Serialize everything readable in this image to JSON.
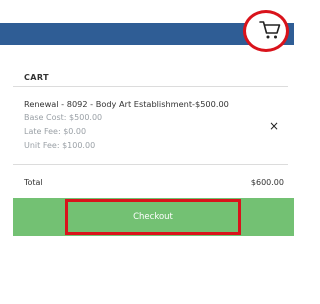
{
  "header": {
    "cart_icon": "shopping-cart-icon",
    "band_color": "#2f5d95",
    "highlight_color": "#d9131b"
  },
  "cart": {
    "heading": "CART",
    "item": {
      "title": "Renewal - 8092 - Body Art Establishment-$500.00",
      "base_cost": "Base Cost: $500.00",
      "late_fee": "Late Fee: $0.00",
      "unit_fee": "Unit Fee: $100.00",
      "remove_label": "×"
    },
    "total_label": "Total",
    "total_value": "$600.00",
    "checkout_label": "Checkout",
    "checkout_color": "#73c173"
  }
}
